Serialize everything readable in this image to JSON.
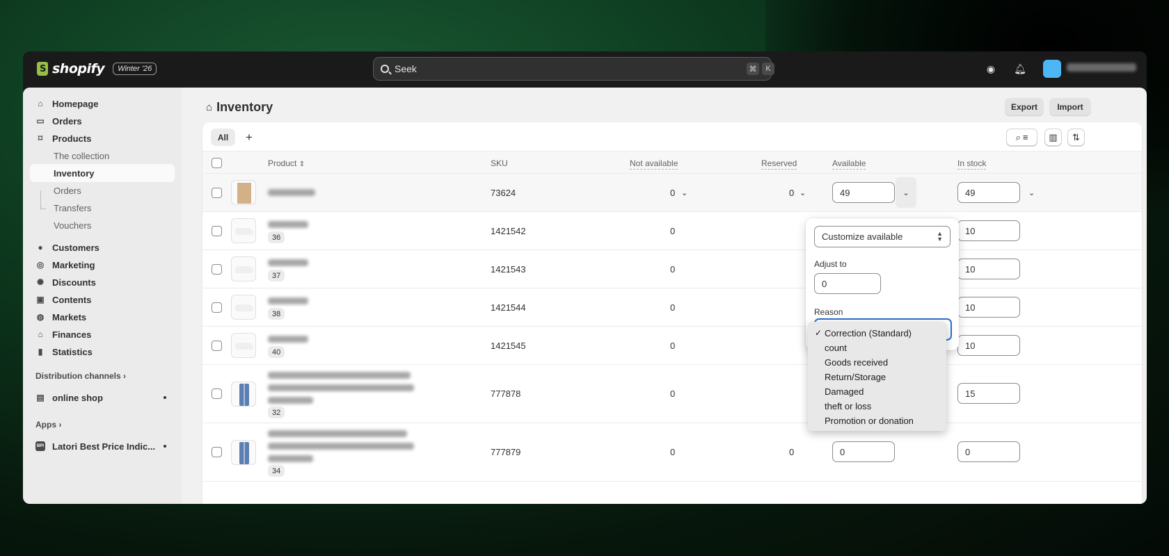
{
  "topbar": {
    "logo_text": "shopify",
    "badge": "Winter '26",
    "search_placeholder": "Seek",
    "shortcut_cmd": "⌘",
    "shortcut_key": "K"
  },
  "sidebar": {
    "items": [
      {
        "label": "Homepage",
        "icon": "home-icon"
      },
      {
        "label": "Orders",
        "icon": "inbox-icon"
      },
      {
        "label": "Products",
        "icon": "tag-icon"
      }
    ],
    "product_subitems": [
      "The collection",
      "Inventory",
      "Orders",
      "Transfers",
      "Vouchers"
    ],
    "items2": [
      {
        "label": "Customers",
        "icon": "person-icon"
      },
      {
        "label": "Marketing",
        "icon": "target-icon"
      },
      {
        "label": "Discounts",
        "icon": "discount-icon"
      },
      {
        "label": "Contents",
        "icon": "image-icon"
      },
      {
        "label": "Markets",
        "icon": "globe-icon"
      },
      {
        "label": "Finances",
        "icon": "bank-icon"
      },
      {
        "label": "Statistics",
        "icon": "bar-chart-icon"
      }
    ],
    "distribution_label": "Distribution channels",
    "online_shop": "online shop",
    "apps_label": "Apps",
    "app_item": "Latori Best Price Indic...",
    "app_icon_text": "BPI"
  },
  "page": {
    "title": "Inventory",
    "export_label": "Export",
    "import_label": "Import",
    "tab_all": "All",
    "tab_add": "+"
  },
  "table": {
    "headers": {
      "product": "Product",
      "sku": "SKU",
      "not_available": "Not available",
      "reserved": "Reserved",
      "available": "Available",
      "in_stock": "In stock"
    },
    "rows": [
      {
        "variant": "",
        "sku": "73624",
        "not_available": "0",
        "reserved": "0",
        "available": "49",
        "in_stock": "49"
      },
      {
        "variant": "36",
        "sku": "1421542",
        "not_available": "0",
        "reserved": "",
        "available": "",
        "in_stock": "10"
      },
      {
        "variant": "37",
        "sku": "1421543",
        "not_available": "0",
        "reserved": "",
        "available": "",
        "in_stock": "10"
      },
      {
        "variant": "38",
        "sku": "1421544",
        "not_available": "0",
        "reserved": "",
        "available": "",
        "in_stock": "10"
      },
      {
        "variant": "40",
        "sku": "1421545",
        "not_available": "0",
        "reserved": "",
        "available": "",
        "in_stock": "10"
      },
      {
        "variant": "32",
        "sku": "777878",
        "not_available": "0",
        "reserved": "",
        "available": "",
        "in_stock": "15"
      },
      {
        "variant": "34",
        "sku": "777879",
        "not_available": "0",
        "reserved": "0",
        "available": "0",
        "in_stock": "0"
      }
    ]
  },
  "popover": {
    "mode": "Customize available",
    "adjust_label": "Adjust to",
    "adjust_value": "0",
    "reason_label": "Reason",
    "reason_options": [
      "Correction (Standard)",
      "count",
      "Goods received",
      "Return/Storage",
      "Damaged",
      "theft or loss",
      "Promotion or donation"
    ],
    "selected_mark": "✓"
  },
  "colors": {
    "topbar": "#1a1a1a",
    "accent_focus": "#2c6ecb",
    "avatar": "#4db6f5",
    "logo_green": "#95bf47"
  }
}
